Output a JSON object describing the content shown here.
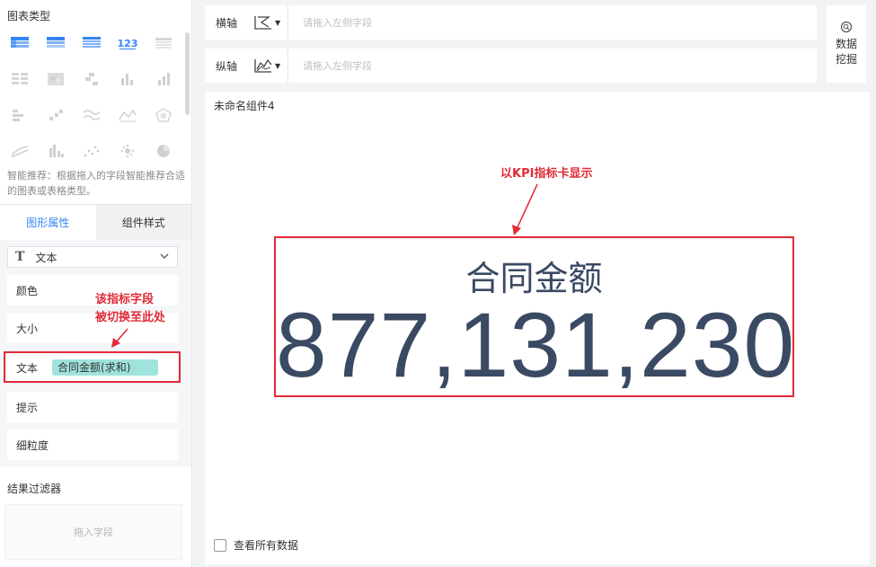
{
  "left": {
    "chart_type_title": "图表类型",
    "smart_tip": "智能推荐：根据拖入的字段智能推荐合适的图表或表格类型。",
    "tabs": [
      {
        "label": "图形属性",
        "active": true
      },
      {
        "label": "组件样式",
        "active": false
      }
    ],
    "mark_type": "文本",
    "props": [
      {
        "label": "颜色"
      },
      {
        "label": "大小"
      },
      {
        "label": "文本",
        "field": "合同金额(求和)"
      },
      {
        "label": "提示"
      },
      {
        "label": "细粒度"
      }
    ],
    "filter_title": "结果过滤器",
    "filter_placeholder": "拖入字段"
  },
  "axes": {
    "x_label": "横轴",
    "y_label": "纵轴",
    "placeholder": "请拖入左侧字段"
  },
  "mining": {
    "line1": "数据",
    "line2": "挖掘"
  },
  "canvas": {
    "widget_title": "未命名组件4",
    "kpi_label": "合同金额",
    "kpi_value": "877,131,230",
    "view_all": "查看所有数据"
  },
  "annotations": {
    "kpi_note": "以KPI指标卡显示",
    "field_note_1": "该指标字段",
    "field_note_2": "被切换至此处"
  },
  "colors": {
    "accent": "#3685f2",
    "annotation": "#e02b36",
    "kpi_text": "#3a4a63",
    "field_pill": "#9fe3dc"
  }
}
